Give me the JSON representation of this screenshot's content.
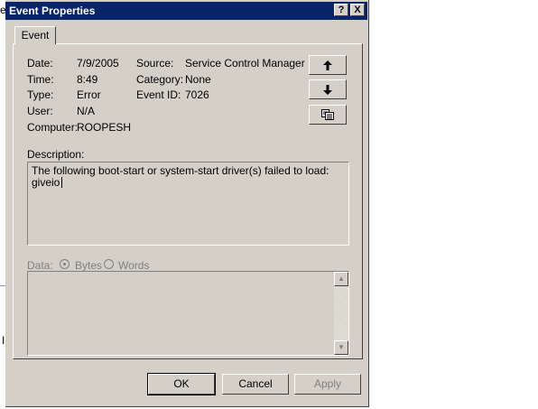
{
  "background": {
    "edge_letter_top": "e",
    "edge_letter_bottom": "I"
  },
  "window": {
    "title": "Event Properties",
    "help_button": "?",
    "close_button": "X",
    "tab_label": "Event"
  },
  "info": {
    "date_label": "Date:",
    "date_value": "7/9/2005",
    "time_label": "Time:",
    "time_value": "8:49",
    "type_label": "Type:",
    "type_value": "Error",
    "user_label": "User:",
    "user_value": "N/A",
    "computer_label": "Computer:",
    "computer_value": "ROOPESH",
    "source_label": "Source:",
    "source_value": "Service Control Manager",
    "category_label": "Category:",
    "category_value": "None",
    "eventid_label": "Event ID:",
    "eventid_value": "7026"
  },
  "description": {
    "label": "Description:",
    "line1": "The following boot-start or system-start driver(s) failed to load:",
    "line2": "giveio"
  },
  "data": {
    "label": "Data:",
    "bytes_label": "Bytes",
    "words_label": "Words",
    "selected": "Bytes"
  },
  "buttons": {
    "ok": "OK",
    "cancel": "Cancel",
    "apply": "Apply"
  },
  "icons": {
    "up": "arrow-up-icon",
    "down": "arrow-down-icon",
    "copy": "copy-icon"
  }
}
